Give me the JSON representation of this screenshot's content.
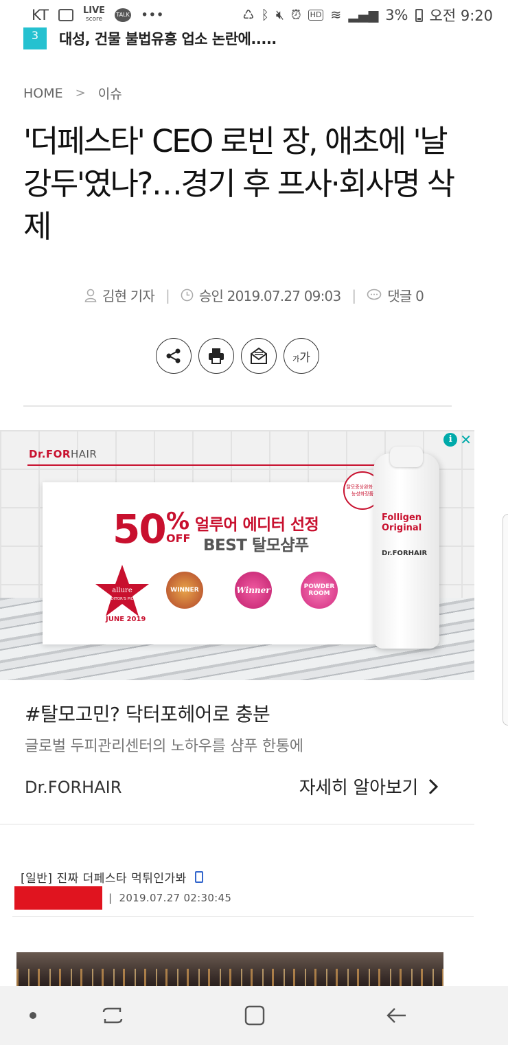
{
  "status_bar": {
    "carrier": "KT",
    "live_label": "LIVE",
    "score_label": "score",
    "talk_label": "TALK",
    "more": "•••",
    "hd_label": "HD",
    "battery": "3%",
    "time": "오전 9:20"
  },
  "ticker": {
    "number": "3",
    "title": "대성, 건물 불법유흥 업소 논란에....."
  },
  "breadcrumb": {
    "home": "HOME",
    "separator": ">",
    "section": "이슈"
  },
  "article": {
    "headline": "'더페스타' CEO 로빈 장, 애초에 '날강두'였나?…경기 후 프사·회사명 삭제",
    "author": "김현 기자",
    "approved": "승인 2019.07.27 09:03",
    "comments": "댓글 0",
    "font_size_label_small": "가",
    "font_size_label_big": "가"
  },
  "ad": {
    "brand_prefix": "Dr.FOR",
    "brand_suffix": "HAIR",
    "big_number": "50",
    "percent": "%",
    "off": "OFF",
    "line1": "얼루어 에디터 선정",
    "line2": "BEST 탈모샴푸",
    "star_title": "allure",
    "star_sub": "EDITOR'S PICK",
    "june": "JUNE 2019",
    "badge1": "WINNER",
    "badge2": "Winner",
    "badge3": "POWDER ROOM",
    "seal_text": "탈모증상완화 기능성화장품",
    "bottle_name": "Folligen Original",
    "bottle_brand": "Dr.FORHAIR",
    "headline": "#탈모고민? 닥터포헤어로 충분",
    "description": "글로벌 두피관리센터의 노하우를 샴푸 한통에",
    "advertiser": "Dr.FORHAIR",
    "cta": "자세히 알아보기",
    "cta_chevron": ">",
    "info_icon": "i",
    "close_icon": "✕",
    "colors": {
      "brand_red": "#c8102e",
      "adchoice_teal": "#00aaaa"
    }
  },
  "embedded_post": {
    "title": "[일반] 진짜 더페스타 먹튀인가봐",
    "date": "2019.07.27 02:30:45"
  },
  "accent_colors": {
    "ticker": "#25c1d0",
    "redaction": "#e0141f"
  }
}
